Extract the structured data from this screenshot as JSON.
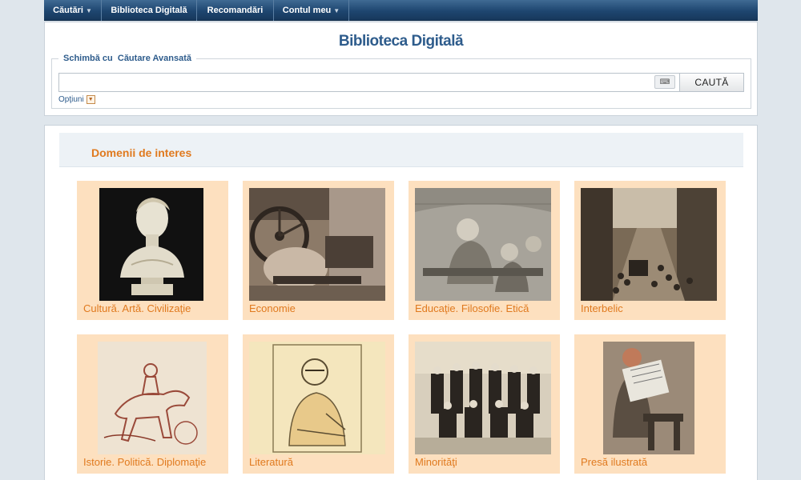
{
  "nav": {
    "items": [
      {
        "label": "Căutări",
        "dropdown": true
      },
      {
        "label": "Biblioteca Digitală",
        "dropdown": false
      },
      {
        "label": "Recomandări",
        "dropdown": false
      },
      {
        "label": "Contul meu",
        "dropdown": true
      }
    ]
  },
  "header": {
    "title": "Biblioteca Digitală",
    "switch_prefix": "Schimbă cu",
    "switch_link": "Căutare Avansată",
    "search_value": "",
    "search_button": "CAUTĂ",
    "options_label": "Opţiuni"
  },
  "section": {
    "title": "Domenii de interes"
  },
  "tiles": [
    {
      "label": "Cultură. Artă. Civilizaţie",
      "icon": "bust-sculpture-image"
    },
    {
      "label": "Economie",
      "icon": "steam-engine-image"
    },
    {
      "label": "Educaţie. Filosofie. Etică",
      "icon": "tavern-engraving-image"
    },
    {
      "label": "Interbelic",
      "icon": "street-crowd-image"
    },
    {
      "label": "Istorie. Politică. Diplomaţie",
      "icon": "horseman-drawing-image"
    },
    {
      "label": "Literatură",
      "icon": "writer-sketch-image"
    },
    {
      "label": "Minorităţi",
      "icon": "group-portrait-image"
    },
    {
      "label": "Presă ilustrată",
      "icon": "newspaper-reader-image"
    }
  ],
  "colors": {
    "nav_bg": "#1e4670",
    "title_blue": "#2e5c8c",
    "accent_orange": "#e07a1f",
    "tile_bg": "#fde0bf"
  }
}
